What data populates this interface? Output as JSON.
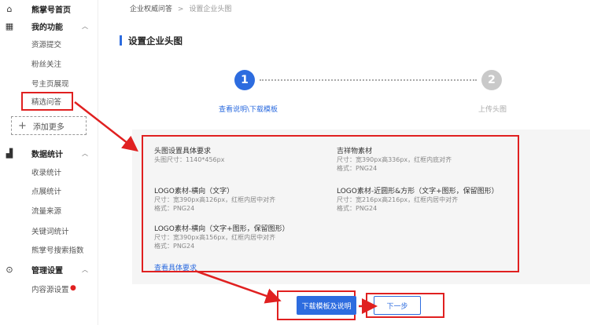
{
  "sidebar": {
    "home": "熊掌号首页",
    "my_features": "我的功能",
    "items_features": [
      "资源提交",
      "粉丝关注",
      "号主页展现",
      "精选问答"
    ],
    "add_more": "添加更多",
    "data_stats": "数据统计",
    "items_stats": [
      "收录统计",
      "点展统计",
      "流量来源",
      "关键词统计",
      "熊掌号搜索指数"
    ],
    "manage": "管理设置",
    "items_manage": [
      "内容源设置"
    ]
  },
  "breadcrumb": {
    "parent": "企业权威问答",
    "separator": ">",
    "current": "设置企业头图"
  },
  "page_title": "设置企业头图",
  "steps": [
    {
      "number": "1",
      "label": "查看说明\\下载模板"
    },
    {
      "number": "2",
      "label": "上传头图"
    }
  ],
  "requirements": {
    "header_img": {
      "title": "头图设置具体要求",
      "lines": [
        "头图尺寸：1140*456px"
      ]
    },
    "mascot": {
      "title": "吉祥物素材",
      "lines": [
        "尺寸：宽390px高336px，红框内底对齐",
        "格式：PNG24"
      ]
    },
    "logo_text": {
      "title": "LOGO素材-横向（文字）",
      "lines": [
        "尺寸：宽390px高126px，红框内居中对齐",
        "格式：PNG24"
      ]
    },
    "logo_square": {
      "title": "LOGO素材-近圆形&方形（文字+图形，保留图形）",
      "lines": [
        "尺寸：宽216px高216px，红框内居中对齐",
        "格式：PNG24"
      ]
    },
    "logo_text_graphic": {
      "title": "LOGO素材-横向（文字+图形，保留图形）",
      "lines": [
        "尺寸：宽390px高156px，红框内居中对齐",
        "格式：PNG24"
      ]
    },
    "view_link": "查看具体要求"
  },
  "buttons": {
    "download": "下载模板及说明",
    "next": "下一步"
  },
  "colors": {
    "accent": "#2d6cdf",
    "annotation": "#e02020"
  }
}
